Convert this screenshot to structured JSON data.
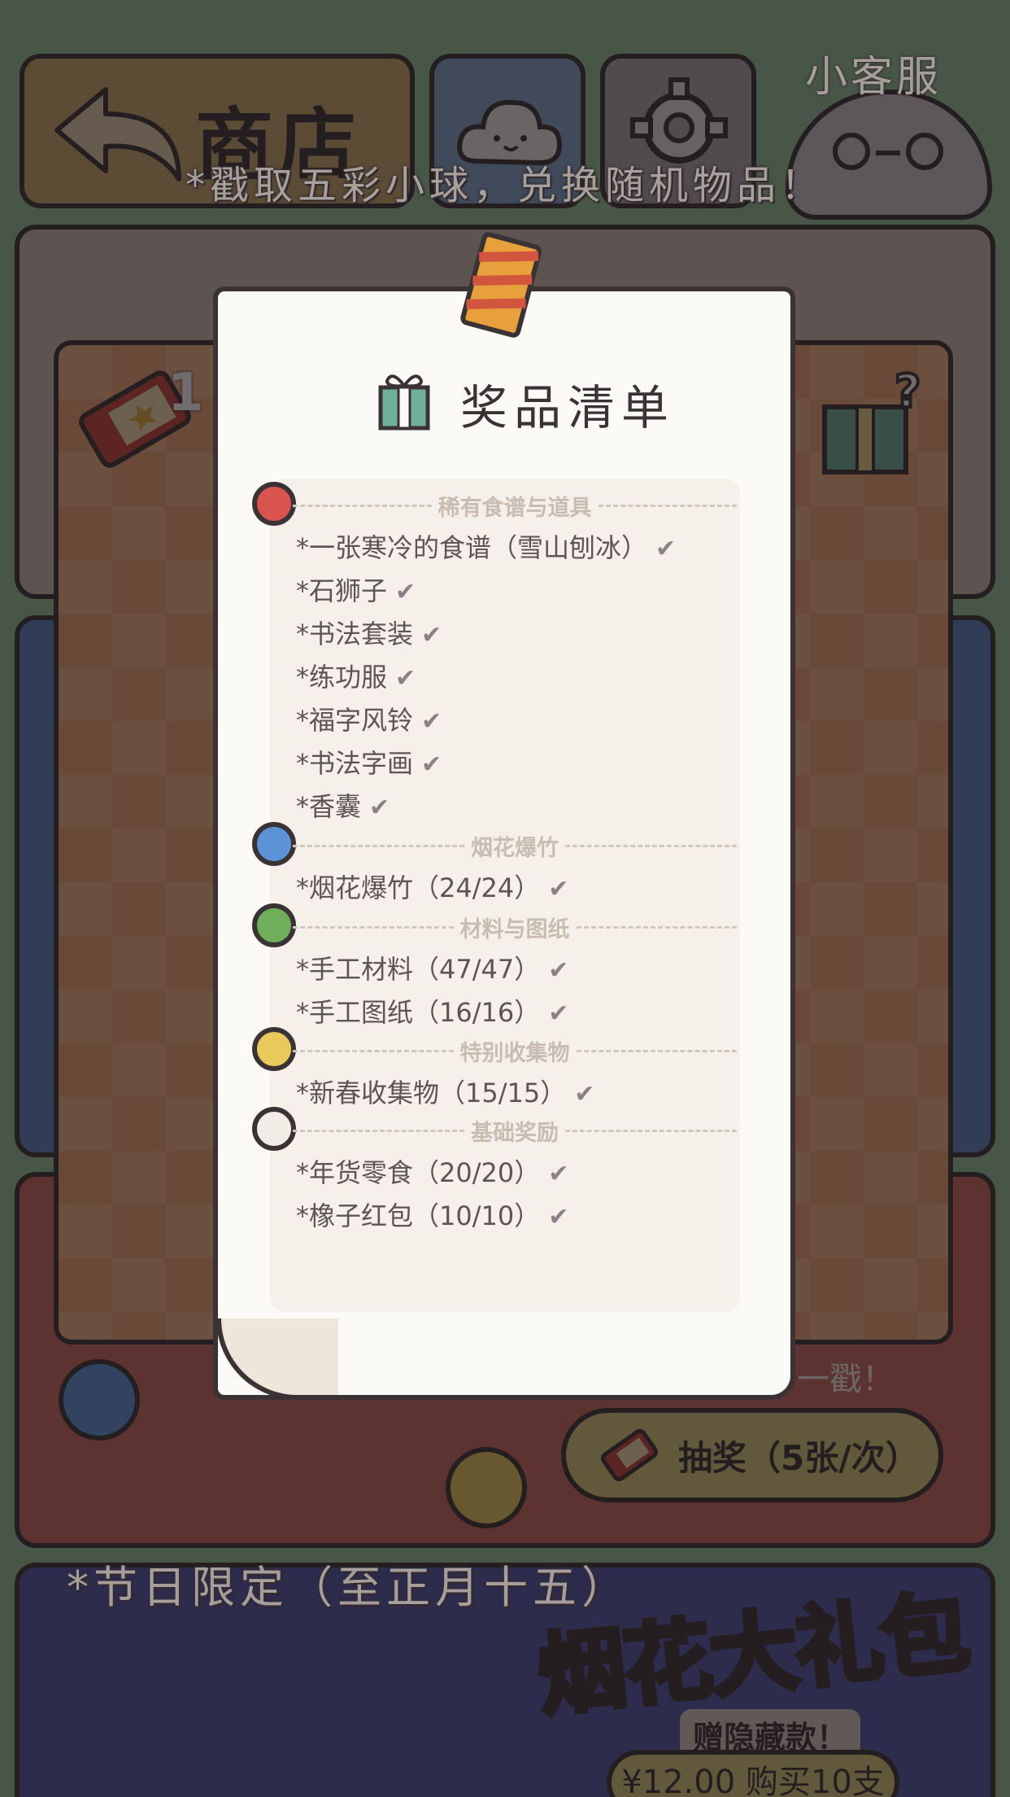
{
  "topbar": {
    "shop_label": "商店",
    "customer_service_label": "小客服"
  },
  "banner_text": "*戳取五彩小球，兑换随机物品！",
  "machine": {
    "ticket_count": "1",
    "footer_hint": "一戳！",
    "draw_button_label": "抽奖（5张/次）"
  },
  "festival": {
    "label": "*节日限定（至正月十五）",
    "title": "烟花大礼包",
    "subtitle": "赠隐藏款！",
    "buy_button_label": "¥12.00 购买10支"
  },
  "prize_list": {
    "title": "奖品清单",
    "sections": [
      {
        "heading": "稀有食谱与道具",
        "ball_color": "#d9534f",
        "items": [
          "*一张寒冷的食谱（雪山刨冰）",
          "*石狮子",
          "*书法套装",
          "*练功服",
          "*福字风铃",
          "*书法字画",
          "*香囊"
        ]
      },
      {
        "heading": "烟花爆竹",
        "ball_color": "#5b93d6",
        "items": [
          "*烟花爆竹（24/24）"
        ]
      },
      {
        "heading": "材料与图纸",
        "ball_color": "#6fae5a",
        "items": [
          "*手工材料（47/47）",
          "*手工图纸（16/16）"
        ]
      },
      {
        "heading": "特别收集物",
        "ball_color": "#e8c95a",
        "items": [
          "*新春收集物（15/15）"
        ]
      },
      {
        "heading": "基础奖励",
        "ball_color": "#f1ede6",
        "items": [
          "*年货零食（20/20）",
          "*橡子红包（10/10）"
        ]
      }
    ],
    "check_glyph": "✔"
  },
  "colors": {
    "background": "#5c7a5e",
    "outline": "#3b3236",
    "paper": "#fcfaf6",
    "button": "#d8cd7a"
  }
}
